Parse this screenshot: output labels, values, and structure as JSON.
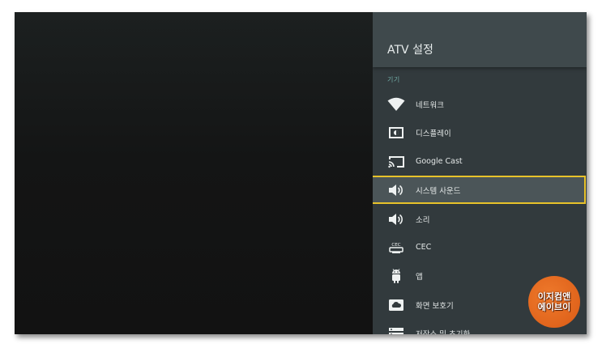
{
  "settings_panel": {
    "title": "ATV 설정",
    "section_label": "기기",
    "items": [
      {
        "label": "네트워크",
        "icon": "wifi-icon"
      },
      {
        "label": "디스플레이",
        "icon": "display-icon"
      },
      {
        "label": "Google Cast",
        "icon": "cast-icon"
      },
      {
        "label": "시스템 사운드",
        "icon": "speaker-icon",
        "selected": true
      },
      {
        "label": "소리",
        "icon": "speaker-icon"
      },
      {
        "label": "CEC",
        "icon": "cec-icon",
        "icon_text": "CEC"
      },
      {
        "label": "앱",
        "icon": "android-icon"
      },
      {
        "label": "화면 보호기",
        "icon": "screensaver-icon"
      },
      {
        "label": "저장소 및 초기화",
        "icon": "storage-icon"
      }
    ]
  },
  "watermark": {
    "line1": "이지컴앤",
    "line2": "에이브이"
  },
  "colors": {
    "panel_background": "#323a3d",
    "header_background": "#3f494c",
    "selection_border": "#e8c22a",
    "section_label": "#6fa9a3",
    "watermark": "#e0641c"
  }
}
